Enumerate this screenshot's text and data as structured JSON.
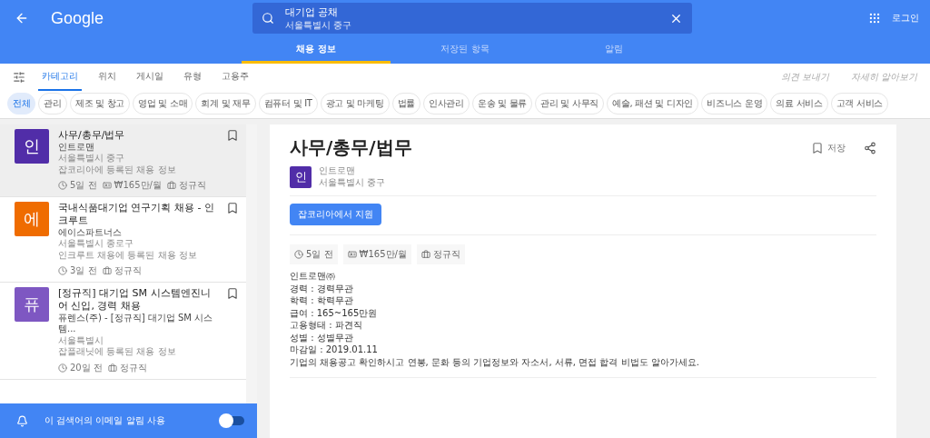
{
  "header": {
    "logo": "Google",
    "search": {
      "value": "대기업 공채",
      "location": "서울특별시 중구"
    },
    "login": "로그인"
  },
  "main_tabs": [
    {
      "label": "채용 정보",
      "selected": true
    },
    {
      "label": "저장된 항목",
      "selected": false
    },
    {
      "label": "알림",
      "selected": false
    }
  ],
  "filter_tabs": [
    {
      "label": "카테고리",
      "selected": true
    },
    {
      "label": "위치",
      "selected": false
    },
    {
      "label": "게시일",
      "selected": false
    },
    {
      "label": "유형",
      "selected": false
    },
    {
      "label": "고용주",
      "selected": false
    }
  ],
  "filter_links": [
    "의견 보내기",
    "자세히 알아보기"
  ],
  "chips": [
    {
      "label": "전체",
      "selected": true
    },
    {
      "label": "관리",
      "selected": false
    },
    {
      "label": "제조 및 창고",
      "selected": false
    },
    {
      "label": "영업 및 소매",
      "selected": false
    },
    {
      "label": "회계 및 재무",
      "selected": false
    },
    {
      "label": "컴퓨터 및 IT",
      "selected": false
    },
    {
      "label": "광고 및 마케팅",
      "selected": false
    },
    {
      "label": "법률",
      "selected": false
    },
    {
      "label": "인사관리",
      "selected": false
    },
    {
      "label": "운송 및 물류",
      "selected": false
    },
    {
      "label": "관리 및 사무직",
      "selected": false
    },
    {
      "label": "예술, 패션 및 디자인",
      "selected": false
    },
    {
      "label": "비즈니스 운영",
      "selected": false
    },
    {
      "label": "의료 서비스",
      "selected": false
    },
    {
      "label": "고객 서비스",
      "selected": false
    }
  ],
  "jobs": [
    {
      "initial": "인",
      "color": "#512da8",
      "title": "사무/총무/법무",
      "company": "인트로맨",
      "location": "서울특별시 중구",
      "source": "잡코리아에 등록된 채용 정보",
      "posted": "5일 전",
      "salary": "₩165만/월",
      "type": "정규직",
      "selected": true
    },
    {
      "initial": "에",
      "color": "#ef6c00",
      "title": "국내식품대기업 연구기획 채용 - 인크루트",
      "company": "에이스파트너스",
      "location": "서울특별시 종로구",
      "source": "인크루트 채용에 등록된 채용 정보",
      "posted": "3일 전",
      "type": "정규직",
      "selected": false
    },
    {
      "initial": "퓨",
      "color": "#7e57c2",
      "title": "[정규직] 대기업 SM 시스템엔진니어 신입, 경력 채용",
      "company": "퓨렌스(주) - [정규직] 대기업 SM 시스템...",
      "location": "서울특별시",
      "source": "잡플래닛에 등록된 채용 정보",
      "posted": "20일 전",
      "type": "정규직",
      "selected": false
    }
  ],
  "alert": {
    "label": "이 검색어의 이메일 알림 사용",
    "on": false
  },
  "detail": {
    "title": "사무/총무/법무",
    "save": "저장",
    "initial": "인",
    "color": "#512da8",
    "company": "인트로맨",
    "location": "서울특별시 중구",
    "apply": "잡코리아에서 지원",
    "posted": "5일 전",
    "salary": "₩165만/월",
    "type": "정규직",
    "lines": [
      "인트로맨㈜",
      "경력 : 경력무관",
      "학력 : 학력무관",
      "급여 : 165~165만원",
      "고용형태 : 파견직",
      "성별 : 성별무관",
      "마감일 : 2019.01.11",
      "기업의 채용공고 확인하시고 연봉, 문화 등의 기업정보와 자소서, 서류, 면접 합격 비법도 알아가세요."
    ]
  }
}
